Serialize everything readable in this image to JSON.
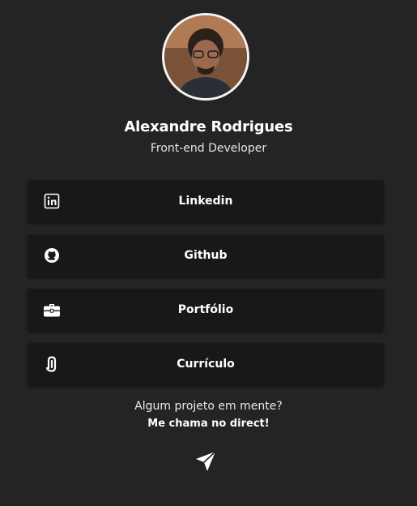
{
  "profile": {
    "name": "Alexandre Rodrigues",
    "role": "Front-end Developer",
    "avatar_icon": "profile-photo"
  },
  "links": [
    {
      "label": "Linkedin",
      "icon": "linkedin-icon"
    },
    {
      "label": "Github",
      "icon": "github-icon"
    },
    {
      "label": "Portfólio",
      "icon": "briefcase-icon"
    },
    {
      "label": "Currículo",
      "icon": "paperclip-icon"
    }
  ],
  "cta": {
    "line1": "Algum projeto em mente?",
    "line2": "Me chama no direct!",
    "icon": "send-icon"
  },
  "colors": {
    "background": "#242424",
    "card": "#181818",
    "text": "#ffffff"
  }
}
